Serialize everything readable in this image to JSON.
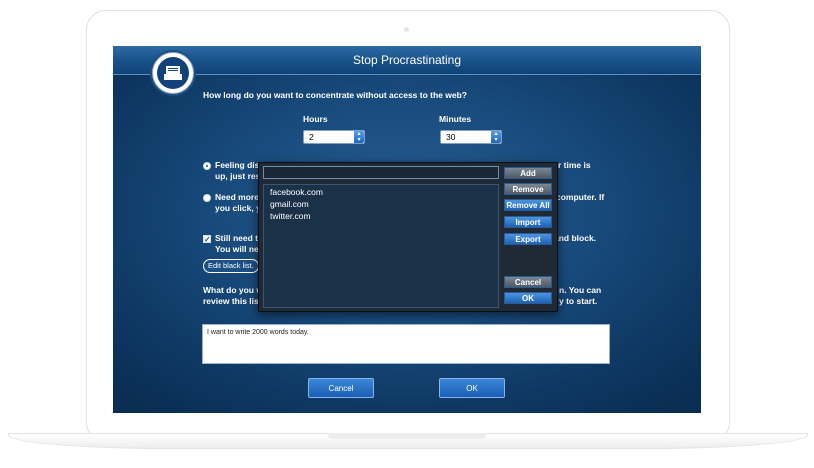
{
  "window": {
    "title": "Stop Procrastinating"
  },
  "question": "How long do you want to concentrate without access to the web?",
  "time": {
    "hours_label": "Hours",
    "hours_value": "2",
    "minutes_label": "Minutes",
    "minutes_value": "30"
  },
  "options": [
    {
      "line1": "Feeling dis",
      "line2": "up, just res",
      "right1": "r time is",
      "right2": "",
      "selected": true
    },
    {
      "line1": "Need more",
      "line2": "you click, y",
      "right1": "computer. If",
      "right2": "",
      "selected": false
    },
    {
      "line1": "Still need to",
      "line2": "You will ne",
      "right1": "and block.",
      "right2": "",
      "checked": true
    }
  ],
  "edit_blacklist_label": "Edit black list.",
  "goal_prompt": {
    "line1": "What do you w",
    "line2": "review this list",
    "right1": "n. You can",
    "right2": "y to start."
  },
  "note_text": "I want to write 2000 words today.",
  "buttons": {
    "cancel": "Cancel",
    "ok": "OK"
  },
  "blacklist_popup": {
    "input_value": "",
    "sites": [
      "facebook.com",
      "gmail.com",
      "twitter.com"
    ],
    "buttons": {
      "add": "Add",
      "remove": "Remove",
      "remove_all": "Remove All",
      "import": "Import",
      "export": "Export",
      "cancel": "Cancel",
      "ok": "OK"
    }
  },
  "colors": {
    "accent": "#1f66c0",
    "screen_bg": "#184a7c"
  }
}
